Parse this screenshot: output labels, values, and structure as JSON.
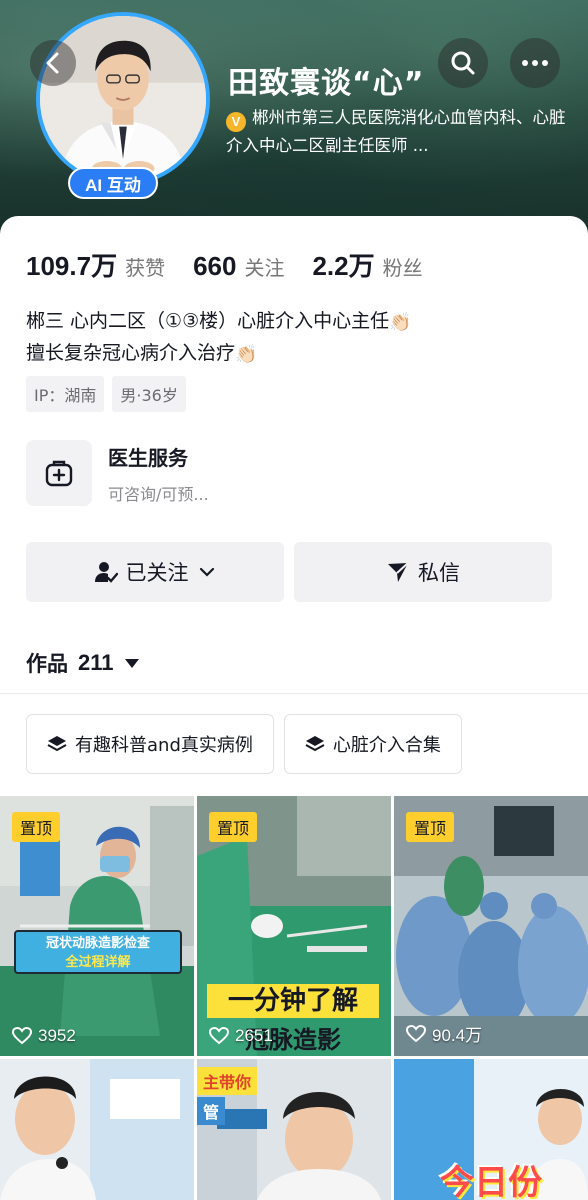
{
  "header": {
    "name": "田致寰谈“心”",
    "ai_badge": "AI 互动",
    "verify_badge": "V",
    "verify_text": "郴州市第三人民医院消化心血管内科、心脏介入中心二区副主任医师 ..."
  },
  "stats": [
    {
      "value": "109.7万",
      "label": "获赞"
    },
    {
      "value": "660",
      "label": "关注"
    },
    {
      "value": "2.2万",
      "label": "粉丝"
    }
  ],
  "bio": {
    "line1": "郴三 心内二区（①③楼）心脏介入中心主任",
    "line2": "擅长复杂冠心病介入治疗",
    "emoji": "👏🏻"
  },
  "tags": [
    "IP：湖南",
    "男·36岁"
  ],
  "service": {
    "title": "医生服务",
    "subtitle": "可咨询/可预..."
  },
  "actions": {
    "follow_label": "已关注",
    "message_label": "私信"
  },
  "works": {
    "label": "作品",
    "count": "211"
  },
  "collections": [
    "有趣科普and真实病例",
    "心脏介入合集"
  ],
  "grid": {
    "pinned_label": "置顶",
    "tiles": [
      {
        "likes": "3952",
        "banner_line1": "冠状动脉造影检查",
        "banner_line2": "全过程详解"
      },
      {
        "likes": "2651",
        "title_line1": "一分钟了解",
        "title_line2": "冠脉造影"
      },
      {
        "likes": "90.4万"
      },
      {},
      {
        "tag": "主带你",
        "tag2": "管"
      },
      {
        "word": "今日份"
      }
    ]
  },
  "colors": {
    "accent_blue": "#2b7df5",
    "pin_yellow": "#fece2d",
    "verify_gold": "#f5b62a"
  }
}
